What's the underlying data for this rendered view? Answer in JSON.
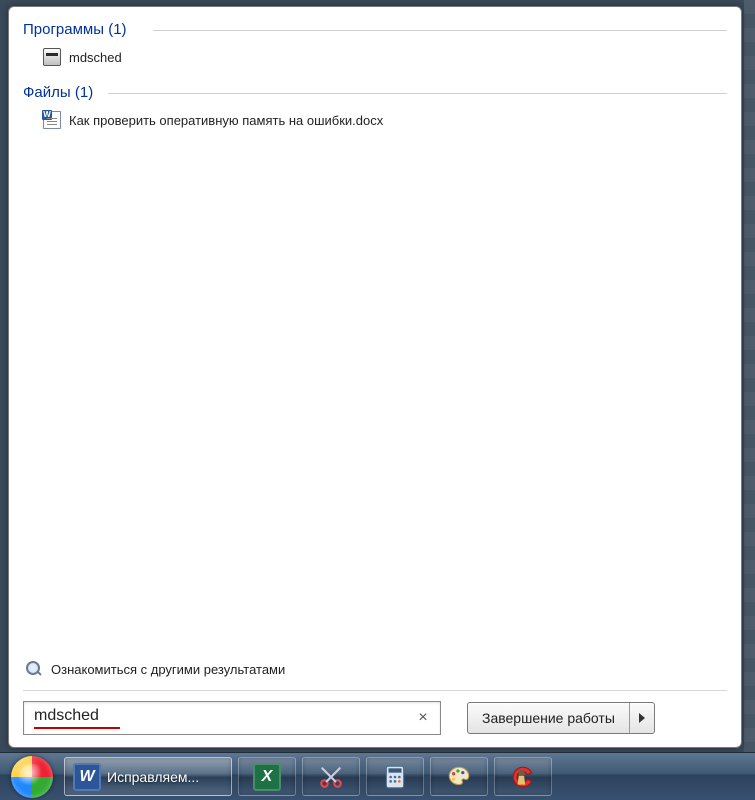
{
  "groups": {
    "programs": {
      "label": "Программы",
      "count": 1,
      "items": [
        {
          "name": "mdsched",
          "icon": "memory-diagnostic-icon"
        }
      ]
    },
    "files": {
      "label": "Файлы",
      "count": 1,
      "items": [
        {
          "name": "Как проверить оперативную память на ошибки.docx",
          "icon": "docx-icon"
        }
      ]
    }
  },
  "more_results_label": "Ознакомиться с другими результатами",
  "search": {
    "value": "mdsched",
    "clear_glyph": "×"
  },
  "shutdown": {
    "label": "Завершение работы"
  },
  "taskbar": {
    "start": "start-orb",
    "items": [
      {
        "id": "word",
        "label": "Исправляем...",
        "icon": "word-icon",
        "active": true
      },
      {
        "id": "excel",
        "icon": "excel-icon"
      },
      {
        "id": "snipping",
        "icon": "scissors-icon"
      },
      {
        "id": "calculator",
        "icon": "calculator-icon"
      },
      {
        "id": "paint",
        "icon": "paint-palette-icon"
      },
      {
        "id": "ccleaner",
        "icon": "ccleaner-icon"
      }
    ]
  }
}
